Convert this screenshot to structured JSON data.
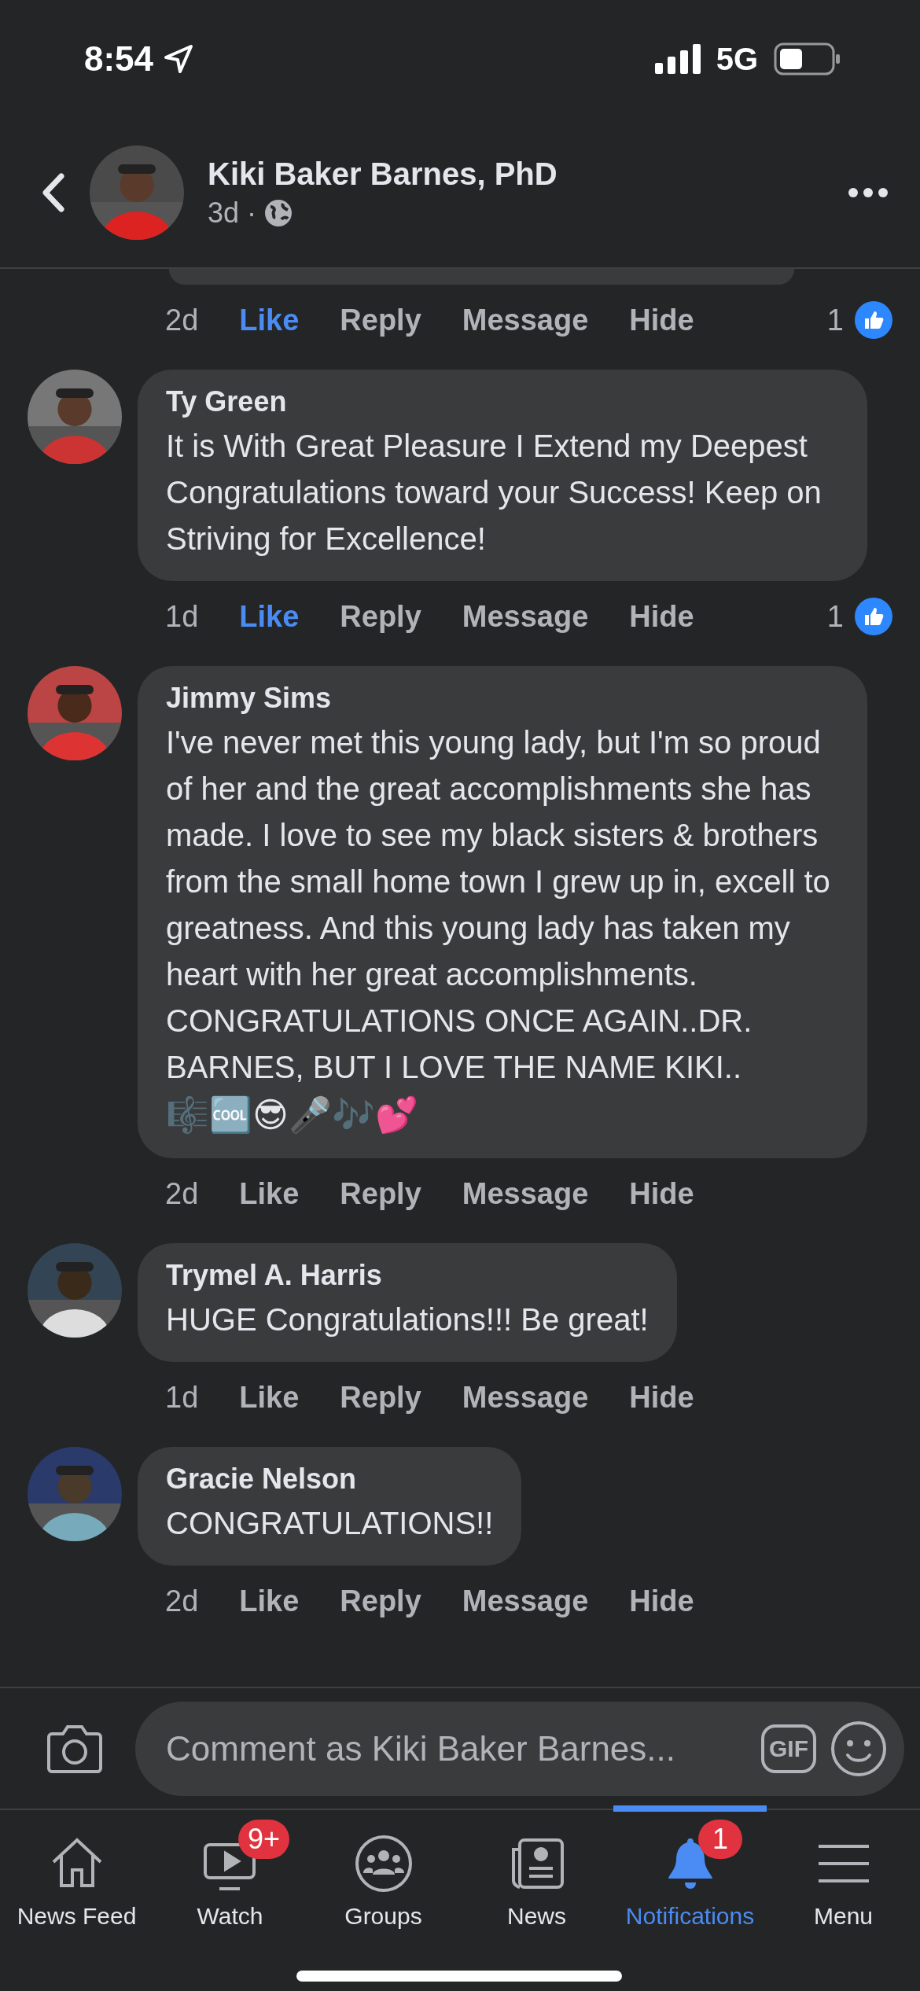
{
  "status_bar": {
    "time": "8:54",
    "network": "5G"
  },
  "header": {
    "name": "Kiki Baker Barnes, PhD",
    "age": "3d ·"
  },
  "comments": [
    {
      "partial": true,
      "time": "2d",
      "like_label": "Like",
      "liked": true,
      "reply": "Reply",
      "message": "Message",
      "hide": "Hide",
      "reactions": "1"
    },
    {
      "partial": false,
      "name": "Ty Green",
      "text": "It is With Great Pleasure I Extend my Deepest Congratulations toward your Success! Keep on Striving for Excellence!",
      "time": "1d",
      "like_label": "Like",
      "liked": true,
      "reply": "Reply",
      "message": "Message",
      "hide": "Hide",
      "reactions": "1"
    },
    {
      "partial": false,
      "name": "Jimmy Sims",
      "text": "I've never met this young lady, but I'm so proud of her and the great accomplishments she has made. I love to see my black sisters & brothers from the small home town I grew up in, excell to greatness. And this young lady has taken my heart with her great accomplishments. CONGRATULATIONS ONCE AGAIN..DR. BARNES, BUT I LOVE THE NAME KIKI..",
      "emoji": "🎼🆒😎🎤🎶💕",
      "time": "2d",
      "like_label": "Like",
      "liked": false,
      "reply": "Reply",
      "message": "Message",
      "hide": "Hide"
    },
    {
      "partial": false,
      "name": "Trymel A. Harris",
      "text": "HUGE Congratulations!!! Be great!",
      "time": "1d",
      "like_label": "Like",
      "liked": false,
      "reply": "Reply",
      "message": "Message",
      "hide": "Hide"
    },
    {
      "partial": false,
      "name": "Gracie Nelson",
      "text": "CONGRATULATIONS!!",
      "time": "2d",
      "like_label": "Like",
      "liked": false,
      "reply": "Reply",
      "message": "Message",
      "hide": "Hide"
    }
  ],
  "composer": {
    "placeholder": "Comment as Kiki Baker Barnes...",
    "gif": "GIF"
  },
  "tabs": [
    {
      "kind": "home",
      "label": "News Feed",
      "selected": false
    },
    {
      "kind": "watch",
      "label": "Watch",
      "selected": false,
      "badge": "9+"
    },
    {
      "kind": "groups",
      "label": "Groups",
      "selected": false
    },
    {
      "kind": "news",
      "label": "News",
      "selected": false
    },
    {
      "kind": "bell",
      "label": "Notifications",
      "selected": true,
      "badge": "1"
    },
    {
      "kind": "menu",
      "label": "Menu",
      "selected": false
    }
  ]
}
